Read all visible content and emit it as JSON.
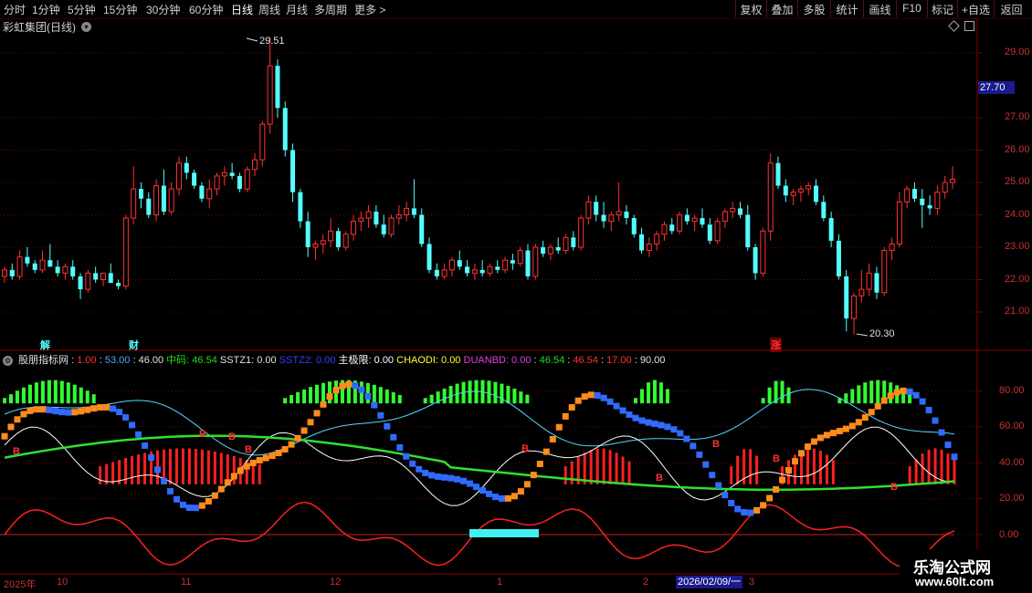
{
  "toolbar": {
    "left_items": [
      "分时",
      "1分钟",
      "5分钟",
      "15分钟",
      "30分钟",
      "60分钟",
      "日线",
      "周线",
      "月线",
      "多周期",
      "更多 >"
    ],
    "right_items": [
      "复权",
      "叠加",
      "多股",
      "统计",
      "画线",
      "F10",
      "标记",
      "+自选",
      "返回"
    ],
    "active": "日线"
  },
  "stock": {
    "title": "彩虹集团(日线)"
  },
  "price_axis": {
    "labels": [
      "29.00",
      "28.00",
      "27.00",
      "26.00",
      "25.00",
      "24.00",
      "23.00",
      "22.00",
      "21.00"
    ],
    "current": "27.70"
  },
  "annotations": {
    "high": "29.51",
    "low": "20.30",
    "markers": [
      "解",
      "财",
      "涨"
    ]
  },
  "indicator": {
    "name": "股朋指标网",
    "values": [
      {
        "text": "1.00",
        "color": "#ff3030"
      },
      {
        "text": "53.00",
        "color": "#4aa8ff"
      },
      {
        "text": "46.00",
        "color": "#e0e0e0"
      },
      {
        "text": "中码: 46.54",
        "color": "#20e020"
      },
      {
        "text": "SSTZ1: 0.00",
        "color": "#e0e0e0"
      },
      {
        "text": "SSTZ2: 0.00",
        "color": "#3a3aff"
      },
      {
        "text": "主极限: 0.00",
        "color": "#ffffff"
      },
      {
        "text": "CHAODI: 0.00",
        "color": "#ffff30"
      },
      {
        "text": "DUANBD: 0.00",
        "color": "#e040e0"
      },
      {
        "text": "46.54",
        "color": "#20e020"
      },
      {
        "text": "46.54",
        "color": "#ff3030"
      },
      {
        "text": "17.00",
        "color": "#ff3030"
      },
      {
        "text": "90.00",
        "color": "#e0e0e0"
      }
    ],
    "axis_labels": [
      "80.00",
      "60.00",
      "40.00",
      "20.00",
      "0.00"
    ],
    "signal_label": "B"
  },
  "date_axis": {
    "labels": [
      "2025年",
      "10",
      "11",
      "12",
      "1",
      "2",
      "3"
    ],
    "current_date": "2026/02/09/一"
  },
  "watermark": {
    "line1": "乐淘公式网",
    "line2": "www.60lt.com"
  },
  "colors": {
    "up": "#ff3232",
    "down": "#54ffff",
    "bg": "#000000",
    "grid": "#7a0000",
    "axis_text": "#c83232"
  },
  "candles": [
    [
      22.1,
      22.4,
      21.9,
      22.3
    ],
    [
      22.3,
      22.5,
      22.0,
      22.1
    ],
    [
      22.1,
      22.9,
      22.0,
      22.7
    ],
    [
      22.7,
      23.0,
      22.4,
      22.5
    ],
    [
      22.5,
      22.6,
      22.2,
      22.3
    ],
    [
      22.3,
      22.9,
      22.2,
      22.6
    ],
    [
      22.6,
      23.1,
      22.4,
      22.4
    ],
    [
      22.4,
      22.6,
      22.1,
      22.2
    ],
    [
      22.2,
      22.5,
      22.0,
      22.4
    ],
    [
      22.4,
      22.6,
      22.0,
      22.1
    ],
    [
      22.1,
      22.2,
      21.4,
      21.7
    ],
    [
      21.7,
      22.3,
      21.6,
      22.2
    ],
    [
      22.2,
      22.4,
      21.9,
      22.0
    ],
    [
      22.0,
      22.1,
      21.8,
      22.2
    ],
    [
      22.2,
      22.5,
      21.9,
      21.9
    ],
    [
      21.9,
      22.0,
      21.7,
      21.8
    ],
    [
      21.8,
      24.0,
      21.7,
      23.9
    ],
    [
      23.9,
      25.5,
      23.7,
      24.8
    ],
    [
      24.8,
      25.0,
      24.2,
      24.5
    ],
    [
      24.5,
      24.7,
      23.9,
      24.0
    ],
    [
      24.0,
      25.1,
      23.8,
      24.9
    ],
    [
      24.9,
      25.4,
      24.0,
      24.1
    ],
    [
      24.1,
      25.0,
      24.0,
      24.8
    ],
    [
      24.8,
      25.8,
      24.6,
      25.6
    ],
    [
      25.6,
      25.8,
      25.1,
      25.3
    ],
    [
      25.3,
      25.4,
      24.8,
      24.9
    ],
    [
      24.9,
      25.0,
      24.4,
      24.5
    ],
    [
      24.5,
      25.1,
      24.2,
      24.8
    ],
    [
      24.8,
      25.3,
      24.6,
      25.2
    ],
    [
      25.2,
      25.5,
      24.9,
      25.3
    ],
    [
      25.3,
      25.6,
      25.1,
      25.2
    ],
    [
      25.2,
      25.3,
      24.7,
      24.8
    ],
    [
      24.8,
      25.5,
      24.7,
      25.4
    ],
    [
      25.4,
      25.9,
      25.2,
      25.7
    ],
    [
      25.7,
      26.9,
      25.5,
      26.8
    ],
    [
      26.8,
      29.5,
      26.5,
      28.6
    ],
    [
      28.6,
      28.8,
      27.0,
      27.3
    ],
    [
      27.3,
      27.5,
      25.8,
      26.0
    ],
    [
      26.0,
      26.2,
      24.4,
      24.7
    ],
    [
      24.7,
      24.8,
      23.6,
      23.8
    ],
    [
      23.8,
      24.1,
      22.7,
      23.0
    ],
    [
      23.0,
      23.2,
      22.6,
      23.1
    ],
    [
      23.1,
      23.4,
      22.8,
      23.2
    ],
    [
      23.2,
      23.9,
      23.0,
      23.5
    ],
    [
      23.5,
      23.6,
      22.9,
      23.0
    ],
    [
      23.0,
      23.5,
      22.9,
      23.4
    ],
    [
      23.4,
      24.0,
      23.2,
      23.8
    ],
    [
      23.8,
      24.1,
      23.5,
      23.9
    ],
    [
      23.9,
      24.3,
      23.6,
      24.1
    ],
    [
      24.1,
      24.3,
      23.6,
      23.7
    ],
    [
      23.7,
      24.0,
      23.3,
      23.4
    ],
    [
      23.4,
      24.0,
      23.3,
      23.9
    ],
    [
      23.9,
      24.3,
      23.7,
      24.0
    ],
    [
      24.0,
      24.4,
      23.8,
      24.2
    ],
    [
      24.2,
      25.1,
      23.9,
      24.0
    ],
    [
      24.0,
      24.2,
      23.0,
      23.1
    ],
    [
      23.1,
      23.3,
      22.2,
      22.3
    ],
    [
      22.3,
      22.5,
      22.0,
      22.1
    ],
    [
      22.1,
      22.5,
      22.0,
      22.3
    ],
    [
      22.3,
      22.7,
      22.1,
      22.6
    ],
    [
      22.6,
      22.9,
      22.3,
      22.4
    ],
    [
      22.4,
      22.6,
      22.1,
      22.2
    ],
    [
      22.2,
      22.5,
      22.0,
      22.3
    ],
    [
      22.3,
      22.6,
      22.1,
      22.2
    ],
    [
      22.2,
      22.5,
      22.1,
      22.4
    ],
    [
      22.4,
      22.6,
      22.2,
      22.3
    ],
    [
      22.3,
      22.7,
      22.2,
      22.6
    ],
    [
      22.6,
      22.8,
      22.3,
      22.5
    ],
    [
      22.5,
      23.0,
      22.4,
      22.9
    ],
    [
      22.9,
      23.1,
      22.0,
      22.1
    ],
    [
      22.1,
      23.1,
      22.0,
      23.0
    ],
    [
      23.0,
      23.2,
      22.7,
      22.8
    ],
    [
      22.8,
      23.1,
      22.6,
      23.0
    ],
    [
      23.0,
      23.3,
      22.8,
      22.9
    ],
    [
      22.9,
      23.4,
      22.8,
      23.3
    ],
    [
      23.3,
      23.5,
      22.9,
      23.0
    ],
    [
      23.0,
      24.0,
      22.9,
      23.9
    ],
    [
      23.9,
      24.6,
      23.7,
      24.4
    ],
    [
      24.4,
      24.6,
      23.8,
      24.0
    ],
    [
      24.0,
      24.4,
      23.6,
      23.8
    ],
    [
      23.8,
      24.1,
      23.5,
      24.0
    ],
    [
      24.0,
      25.0,
      23.8,
      24.1
    ],
    [
      24.1,
      24.3,
      23.7,
      23.9
    ],
    [
      23.9,
      24.0,
      23.3,
      23.4
    ],
    [
      23.4,
      23.6,
      22.8,
      22.9
    ],
    [
      22.9,
      23.3,
      22.7,
      23.1
    ],
    [
      23.1,
      23.5,
      22.9,
      23.4
    ],
    [
      23.4,
      23.8,
      23.2,
      23.7
    ],
    [
      23.7,
      23.9,
      23.4,
      23.5
    ],
    [
      23.5,
      24.1,
      23.4,
      24.0
    ],
    [
      24.0,
      24.2,
      23.7,
      23.8
    ],
    [
      23.8,
      24.0,
      23.5,
      23.9
    ],
    [
      23.9,
      24.2,
      23.6,
      23.7
    ],
    [
      23.7,
      23.9,
      23.1,
      23.2
    ],
    [
      23.2,
      23.9,
      23.1,
      23.8
    ],
    [
      23.8,
      24.2,
      23.6,
      24.1
    ],
    [
      24.1,
      24.4,
      23.9,
      24.2
    ],
    [
      24.2,
      24.4,
      23.9,
      24.0
    ],
    [
      24.0,
      24.3,
      22.9,
      23.0
    ],
    [
      23.0,
      23.1,
      22.0,
      22.2
    ],
    [
      22.2,
      23.6,
      22.1,
      23.5
    ],
    [
      23.5,
      25.9,
      23.2,
      25.6
    ],
    [
      25.6,
      25.8,
      24.8,
      24.9
    ],
    [
      24.9,
      25.1,
      24.4,
      24.6
    ],
    [
      24.6,
      24.8,
      24.3,
      24.7
    ],
    [
      24.7,
      24.9,
      24.4,
      24.8
    ],
    [
      24.8,
      25.0,
      24.6,
      24.9
    ],
    [
      24.9,
      25.1,
      24.3,
      24.4
    ],
    [
      24.4,
      24.6,
      23.8,
      23.9
    ],
    [
      23.9,
      24.1,
      23.0,
      23.2
    ],
    [
      23.2,
      23.4,
      22.0,
      22.1
    ],
    [
      22.1,
      22.3,
      20.4,
      20.8
    ],
    [
      20.8,
      21.6,
      20.3,
      21.5
    ],
    [
      21.5,
      22.3,
      21.3,
      21.7
    ],
    [
      21.7,
      22.5,
      21.5,
      22.2
    ],
    [
      22.2,
      22.4,
      21.4,
      21.6
    ],
    [
      21.6,
      23.0,
      21.5,
      22.9
    ],
    [
      22.9,
      23.3,
      22.6,
      23.1
    ],
    [
      23.1,
      24.7,
      23.0,
      24.4
    ],
    [
      24.4,
      24.9,
      24.2,
      24.8
    ],
    [
      24.8,
      25.0,
      24.4,
      24.5
    ],
    [
      24.5,
      24.8,
      23.6,
      24.3
    ],
    [
      24.3,
      24.6,
      24.0,
      24.2
    ],
    [
      24.2,
      24.9,
      24.0,
      24.7
    ],
    [
      24.7,
      25.2,
      24.5,
      25.0
    ],
    [
      25.0,
      25.5,
      24.8,
      25.1
    ]
  ]
}
